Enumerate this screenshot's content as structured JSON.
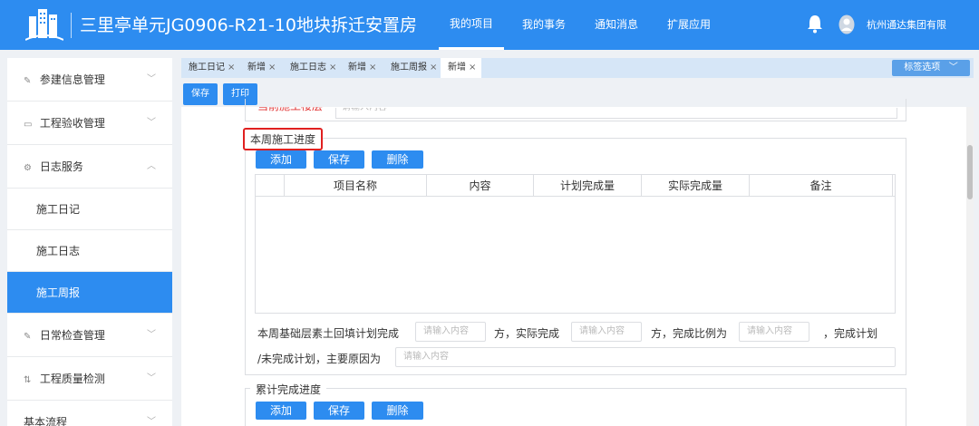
{
  "header": {
    "title": "三里亭单元JG0906-R21-10地块拆迁安置房",
    "nav": [
      {
        "label": "我的项目",
        "active": true
      },
      {
        "label": "我的事务",
        "active": false
      },
      {
        "label": "通知消息",
        "active": false
      },
      {
        "label": "扩展应用",
        "active": false
      }
    ],
    "company": "杭州通达集团有限",
    "colors": {
      "brand": "#2d8cf0"
    }
  },
  "sidebar": {
    "items": [
      {
        "label": "参建信息管理",
        "icon": "edit-icon"
      },
      {
        "label": "工程验收管理",
        "icon": "monitor-icon"
      },
      {
        "label": "日志服务",
        "icon": "gear-icon",
        "expanded": true
      }
    ],
    "sub_items": [
      {
        "label": "施工日记"
      },
      {
        "label": "施工日志"
      },
      {
        "label": "施工周报",
        "active": true
      }
    ],
    "items_after": [
      {
        "label": "日常检查管理",
        "icon": "edit-icon"
      },
      {
        "label": "工程质量检测",
        "icon": "chart-icon"
      },
      {
        "label": "基本流程",
        "icon": "none"
      }
    ]
  },
  "tabs": {
    "items": [
      {
        "label": "施工日记",
        "close": "×"
      },
      {
        "label": "新增",
        "close": "×"
      },
      {
        "label": "施工日志",
        "close": "×"
      },
      {
        "label": "新增",
        "close": "×"
      },
      {
        "label": "施工周报",
        "close": "×"
      },
      {
        "label": "新增",
        "close": "×",
        "active": true
      }
    ],
    "options_label": "标签选项"
  },
  "toolbar": {
    "save_label": "保存",
    "print_label": "打印"
  },
  "form": {
    "prev_label": "当前施工楼层",
    "prev_placeholder": "请输入内容",
    "section1": {
      "legend": "本周施工进度",
      "add_label": "添加",
      "save_label": "保存",
      "delete_label": "删除",
      "columns": [
        "",
        "项目名称",
        "内容",
        "计划完成量",
        "实际完成量",
        "备注"
      ],
      "text1": "本周基础层素土回填计划完成",
      "text2": "方，实际完成",
      "text3": "方，完成比例为",
      "text4": "，完成计划",
      "text5": "/未完成计划，主要原因为",
      "placeholder": "请输入内容"
    },
    "section2": {
      "legend": "累计完成进度",
      "add_label": "添加",
      "save_label": "保存",
      "delete_label": "删除"
    }
  }
}
